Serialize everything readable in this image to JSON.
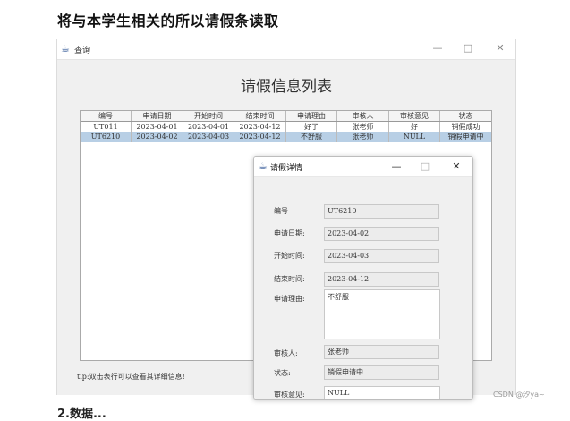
{
  "page_heading": "将与本学生相关的所以请假条读取",
  "main_window": {
    "title": "查询",
    "minimize": "—",
    "maximize": "□",
    "close": "✕",
    "list_heading": "请假信息列表",
    "table": {
      "columns": [
        "编号",
        "申请日期",
        "开始时间",
        "结束时间",
        "申请理由",
        "审核人",
        "审核意见",
        "状态"
      ],
      "rows": [
        [
          "UT011",
          "2023-04-01",
          "2023-04-01",
          "2023-04-12",
          "好了",
          "张老师",
          "好",
          "销假成功"
        ],
        [
          "UT6210",
          "2023-04-02",
          "2023-04-03",
          "2023-04-12",
          "不舒服",
          "张老师",
          "NULL",
          "销假申请中"
        ]
      ],
      "selected_row": 1
    },
    "tip": "tip:双击表行可以查看其详细信息!"
  },
  "dialog": {
    "title": "请假详情",
    "minimize": "—",
    "maximize": "□",
    "close": "✕",
    "fields": {
      "id_label": "编号",
      "id_value": "UT6210",
      "apply_date_label": "申请日期:",
      "apply_date_value": "2023-04-02",
      "start_label": "开始时间:",
      "start_value": "2023-04-03",
      "end_label": "结束时间:",
      "end_value": "2023-04-12",
      "reason_label": "申请理由:",
      "reason_value": "不舒服",
      "reviewer_label": "审核人:",
      "reviewer_value": "张老师",
      "status_label": "状态:",
      "status_value": "销假申请中",
      "opinion_label": "审核意见:",
      "opinion_value": "NULL"
    }
  },
  "watermark": "CSDN @汐ya~",
  "bottom_fragment": "2.数据..."
}
